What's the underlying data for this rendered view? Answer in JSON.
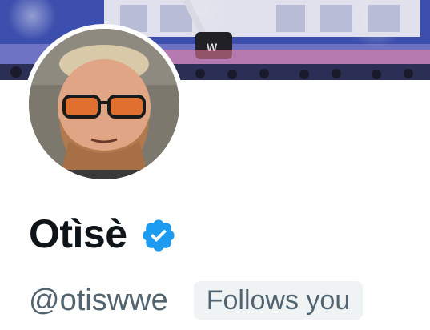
{
  "profile": {
    "display_name": "Otìsè",
    "handle": "@otiswwe",
    "follows_you_label": "Follows you",
    "verified": true
  },
  "colors": {
    "name_text": "#0f1419",
    "secondary_text": "#536471",
    "badge_bg": "#eff3f4",
    "verified_blue": "#1d9bf0"
  },
  "icons": {
    "verified": "verified-badge-icon"
  }
}
